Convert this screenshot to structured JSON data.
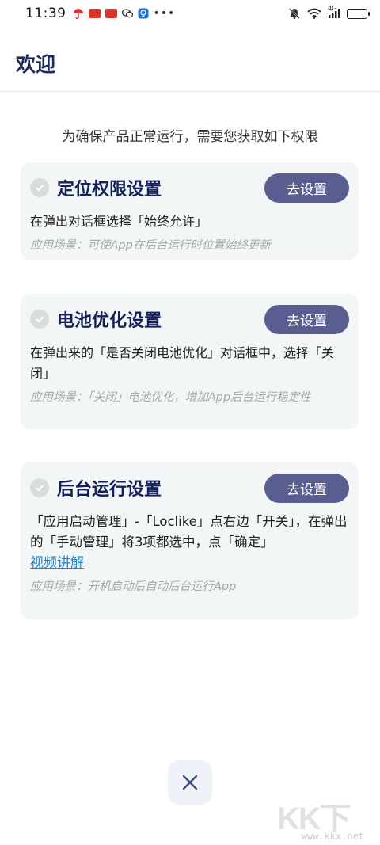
{
  "status_bar": {
    "time": "11:39",
    "network": "4G",
    "dots": "•••"
  },
  "header": {
    "title": "欢迎"
  },
  "intro": "为确保产品正常运行，需要您获取如下权限",
  "cards": [
    {
      "title": "定位权限设置",
      "button": "去设置",
      "desc": "在弹出对话框选择「始终允许」",
      "scene": "应用场景：可使App在后台运行时位置始终更新"
    },
    {
      "title": "电池优化设置",
      "button": "去设置",
      "desc": "在弹出来的「是否关闭电池优化」对话框中，选择「关闭」",
      "scene": "应用场景：「关闭」电池优化，增加App后台运行稳定性"
    },
    {
      "title": "后台运行设置",
      "button": "去设置",
      "desc": "「应用启动管理」-「Loclike」点右边「开关」，在弹出的「手动管理」将3项都选中，点「确定」",
      "link": "视频讲解",
      "scene": "应用场景：开机启动后自动后台运行App"
    }
  ],
  "watermark": {
    "text": "KK下载",
    "url": "www.kkx.net"
  },
  "colors": {
    "title": "#1d2a5e",
    "button_bg": "#5a5d8f",
    "card_bg": "#f3f6f6",
    "link": "#1a86d6"
  }
}
